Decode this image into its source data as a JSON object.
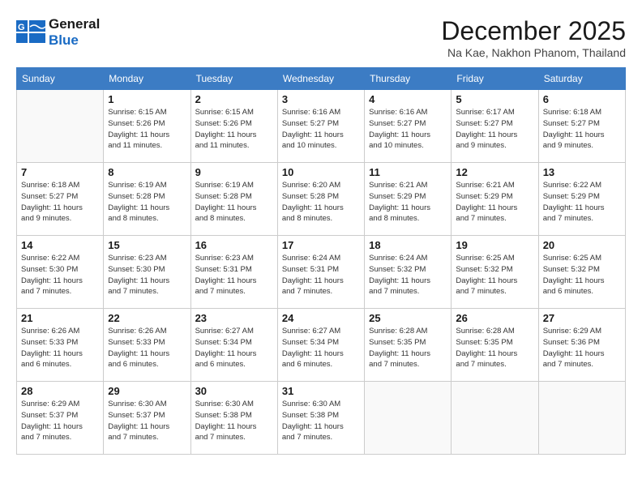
{
  "logo": {
    "line1": "General",
    "line2": "Blue"
  },
  "title": "December 2025",
  "location": "Na Kae, Nakhon Phanom, Thailand",
  "days_of_week": [
    "Sunday",
    "Monday",
    "Tuesday",
    "Wednesday",
    "Thursday",
    "Friday",
    "Saturday"
  ],
  "weeks": [
    [
      {
        "day": null,
        "info": null
      },
      {
        "day": "1",
        "info": "Sunrise: 6:15 AM\nSunset: 5:26 PM\nDaylight: 11 hours\nand 11 minutes."
      },
      {
        "day": "2",
        "info": "Sunrise: 6:15 AM\nSunset: 5:26 PM\nDaylight: 11 hours\nand 11 minutes."
      },
      {
        "day": "3",
        "info": "Sunrise: 6:16 AM\nSunset: 5:27 PM\nDaylight: 11 hours\nand 10 minutes."
      },
      {
        "day": "4",
        "info": "Sunrise: 6:16 AM\nSunset: 5:27 PM\nDaylight: 11 hours\nand 10 minutes."
      },
      {
        "day": "5",
        "info": "Sunrise: 6:17 AM\nSunset: 5:27 PM\nDaylight: 11 hours\nand 9 minutes."
      },
      {
        "day": "6",
        "info": "Sunrise: 6:18 AM\nSunset: 5:27 PM\nDaylight: 11 hours\nand 9 minutes."
      }
    ],
    [
      {
        "day": "7",
        "info": "Sunrise: 6:18 AM\nSunset: 5:27 PM\nDaylight: 11 hours\nand 9 minutes."
      },
      {
        "day": "8",
        "info": "Sunrise: 6:19 AM\nSunset: 5:28 PM\nDaylight: 11 hours\nand 8 minutes."
      },
      {
        "day": "9",
        "info": "Sunrise: 6:19 AM\nSunset: 5:28 PM\nDaylight: 11 hours\nand 8 minutes."
      },
      {
        "day": "10",
        "info": "Sunrise: 6:20 AM\nSunset: 5:28 PM\nDaylight: 11 hours\nand 8 minutes."
      },
      {
        "day": "11",
        "info": "Sunrise: 6:21 AM\nSunset: 5:29 PM\nDaylight: 11 hours\nand 8 minutes."
      },
      {
        "day": "12",
        "info": "Sunrise: 6:21 AM\nSunset: 5:29 PM\nDaylight: 11 hours\nand 7 minutes."
      },
      {
        "day": "13",
        "info": "Sunrise: 6:22 AM\nSunset: 5:29 PM\nDaylight: 11 hours\nand 7 minutes."
      }
    ],
    [
      {
        "day": "14",
        "info": "Sunrise: 6:22 AM\nSunset: 5:30 PM\nDaylight: 11 hours\nand 7 minutes."
      },
      {
        "day": "15",
        "info": "Sunrise: 6:23 AM\nSunset: 5:30 PM\nDaylight: 11 hours\nand 7 minutes."
      },
      {
        "day": "16",
        "info": "Sunrise: 6:23 AM\nSunset: 5:31 PM\nDaylight: 11 hours\nand 7 minutes."
      },
      {
        "day": "17",
        "info": "Sunrise: 6:24 AM\nSunset: 5:31 PM\nDaylight: 11 hours\nand 7 minutes."
      },
      {
        "day": "18",
        "info": "Sunrise: 6:24 AM\nSunset: 5:32 PM\nDaylight: 11 hours\nand 7 minutes."
      },
      {
        "day": "19",
        "info": "Sunrise: 6:25 AM\nSunset: 5:32 PM\nDaylight: 11 hours\nand 7 minutes."
      },
      {
        "day": "20",
        "info": "Sunrise: 6:25 AM\nSunset: 5:32 PM\nDaylight: 11 hours\nand 6 minutes."
      }
    ],
    [
      {
        "day": "21",
        "info": "Sunrise: 6:26 AM\nSunset: 5:33 PM\nDaylight: 11 hours\nand 6 minutes."
      },
      {
        "day": "22",
        "info": "Sunrise: 6:26 AM\nSunset: 5:33 PM\nDaylight: 11 hours\nand 6 minutes."
      },
      {
        "day": "23",
        "info": "Sunrise: 6:27 AM\nSunset: 5:34 PM\nDaylight: 11 hours\nand 6 minutes."
      },
      {
        "day": "24",
        "info": "Sunrise: 6:27 AM\nSunset: 5:34 PM\nDaylight: 11 hours\nand 6 minutes."
      },
      {
        "day": "25",
        "info": "Sunrise: 6:28 AM\nSunset: 5:35 PM\nDaylight: 11 hours\nand 7 minutes."
      },
      {
        "day": "26",
        "info": "Sunrise: 6:28 AM\nSunset: 5:35 PM\nDaylight: 11 hours\nand 7 minutes."
      },
      {
        "day": "27",
        "info": "Sunrise: 6:29 AM\nSunset: 5:36 PM\nDaylight: 11 hours\nand 7 minutes."
      }
    ],
    [
      {
        "day": "28",
        "info": "Sunrise: 6:29 AM\nSunset: 5:37 PM\nDaylight: 11 hours\nand 7 minutes."
      },
      {
        "day": "29",
        "info": "Sunrise: 6:30 AM\nSunset: 5:37 PM\nDaylight: 11 hours\nand 7 minutes."
      },
      {
        "day": "30",
        "info": "Sunrise: 6:30 AM\nSunset: 5:38 PM\nDaylight: 11 hours\nand 7 minutes."
      },
      {
        "day": "31",
        "info": "Sunrise: 6:30 AM\nSunset: 5:38 PM\nDaylight: 11 hours\nand 7 minutes."
      },
      {
        "day": null,
        "info": null
      },
      {
        "day": null,
        "info": null
      },
      {
        "day": null,
        "info": null
      }
    ]
  ]
}
